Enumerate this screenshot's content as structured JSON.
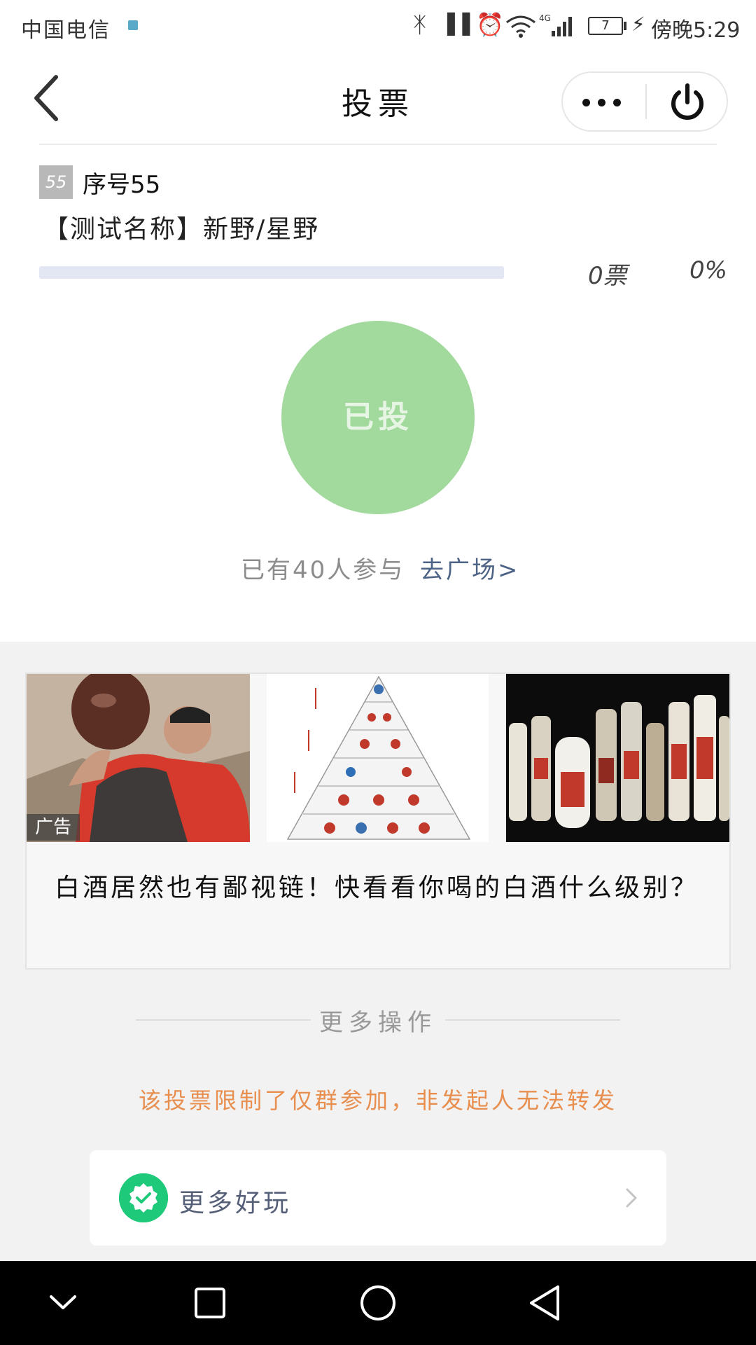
{
  "status_bar": {
    "carrier": "中国电信",
    "battery": "7",
    "time": "傍晚5:29"
  },
  "nav": {
    "title": "投票"
  },
  "option": {
    "serial_badge": "55",
    "serial_label": "序号55",
    "name": "【测试名称】新野/星野",
    "votes": "0票",
    "percent": "0%",
    "progress_fraction": 0
  },
  "vote_button": {
    "label": "已投"
  },
  "participation": {
    "text": "已有40人参与",
    "link": "去广场>"
  },
  "ad": {
    "tag": "广告",
    "text": "白酒居然也有鄙视链！快看看你喝的白酒什么级别？"
  },
  "more": {
    "title": "更多操作",
    "forward_notice": "该投票限制了仅群参加，非发起人无法转发",
    "more_fun_label": "更多好玩"
  },
  "colors": {
    "voted_green": "#a2d99d",
    "link_blue": "#4d6386",
    "notice_orange": "#e88e4f",
    "badge_green": "#1fc97a"
  }
}
